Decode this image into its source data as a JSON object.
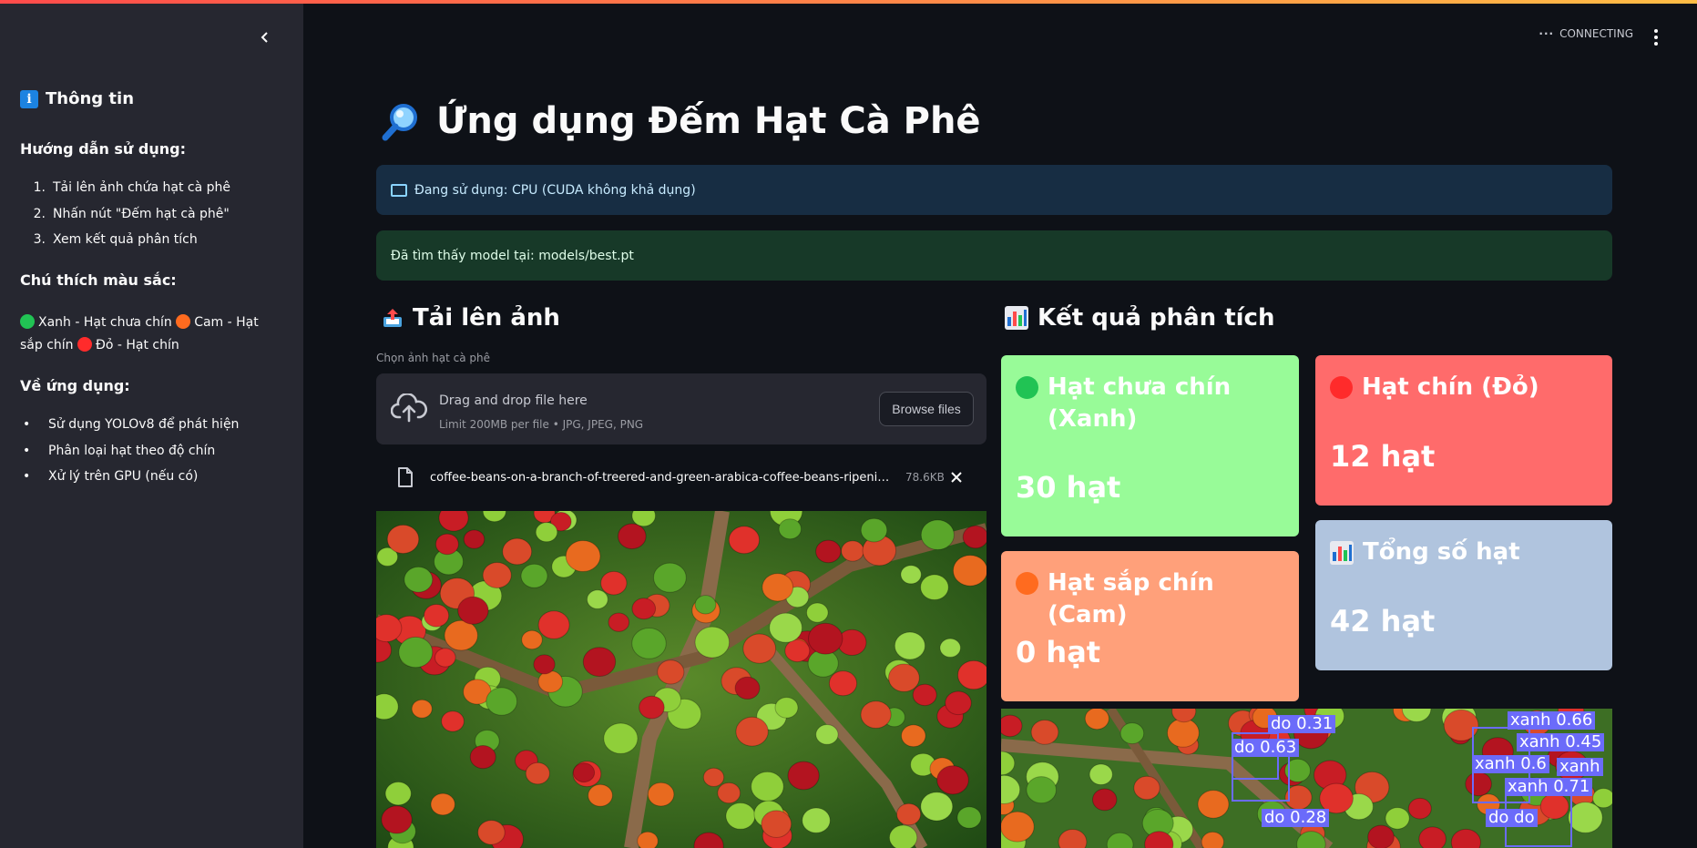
{
  "sidebar": {
    "title": "Thông tin",
    "guide_heading": "Hướng dẫn sử dụng:",
    "steps": [
      {
        "num": "1.",
        "text": "Tải lên ảnh chứa hạt cà phê"
      },
      {
        "num": "2.",
        "text": "Nhấn nút \"Đếm hạt cà phê\""
      },
      {
        "num": "3.",
        "text": "Xem kết quả phân tích"
      }
    ],
    "legend_heading": "Chú thích màu sắc:",
    "legend": [
      {
        "color": "#21c354",
        "text": "Xanh - Hạt chưa chín"
      },
      {
        "color": "#ff6b1f",
        "text": "Cam - Hạt sắp chín"
      },
      {
        "color": "#ff2b2b",
        "text": "Đỏ - Hạt chín"
      }
    ],
    "about_heading": "Về ứng dụng:",
    "about_items": [
      "Sử dụng YOLOv8 để phát hiện",
      "Phân loại hạt theo độ chín",
      "Xử lý trên GPU (nếu có)"
    ]
  },
  "header": {
    "status": "CONNECTING"
  },
  "main": {
    "title": "Ứng dụng Đếm Hạt Cà Phê",
    "device_info": "Đang sử dụng: CPU (CUDA không khả dụng)",
    "model_info": "Đã tìm thấy model tại: models/best.pt",
    "upload": {
      "heading": "Tải lên ảnh",
      "label": "Chọn ảnh hạt cà phê",
      "drop_text": "Drag and drop file here",
      "limit_text": "Limit 200MB per file • JPG, JPEG, PNG",
      "browse_label": "Browse files",
      "file_name": "coffee-beans-on-a-branch-of-treered-and-green-arabica-coffee-beans-ripening-on-the-tree.jpg",
      "file_size": "78.6KB"
    },
    "results": {
      "heading": "Kết quả phân tích",
      "cards": {
        "green": {
          "title": "Hạt chưa chín (Xanh)",
          "value": "30 hạt",
          "bg": "#98fb98",
          "dot": "#21c354"
        },
        "red": {
          "title": "Hạt chín (Đỏ)",
          "value": "12 hạt",
          "bg": "#ff6b6b",
          "dot": "#ff2b2b"
        },
        "orange": {
          "title": "Hạt sắp chín (Cam)",
          "value": "0 hạt",
          "bg": "#ffa07a",
          "dot": "#ff6b1f"
        },
        "total": {
          "title": "Tổng số hạt",
          "value": "42 hạt",
          "bg": "#b0c4de"
        }
      },
      "detections": [
        {
          "label": "do 0.31"
        },
        {
          "label": "do 0.63"
        },
        {
          "label": "do 0.28"
        },
        {
          "label": "xanh 0.66"
        },
        {
          "label": "xanh 0.45"
        },
        {
          "label": "xanh 0.6"
        },
        {
          "label": "xanh"
        },
        {
          "label": "xanh 0.71"
        },
        {
          "label": "do do"
        }
      ]
    }
  }
}
